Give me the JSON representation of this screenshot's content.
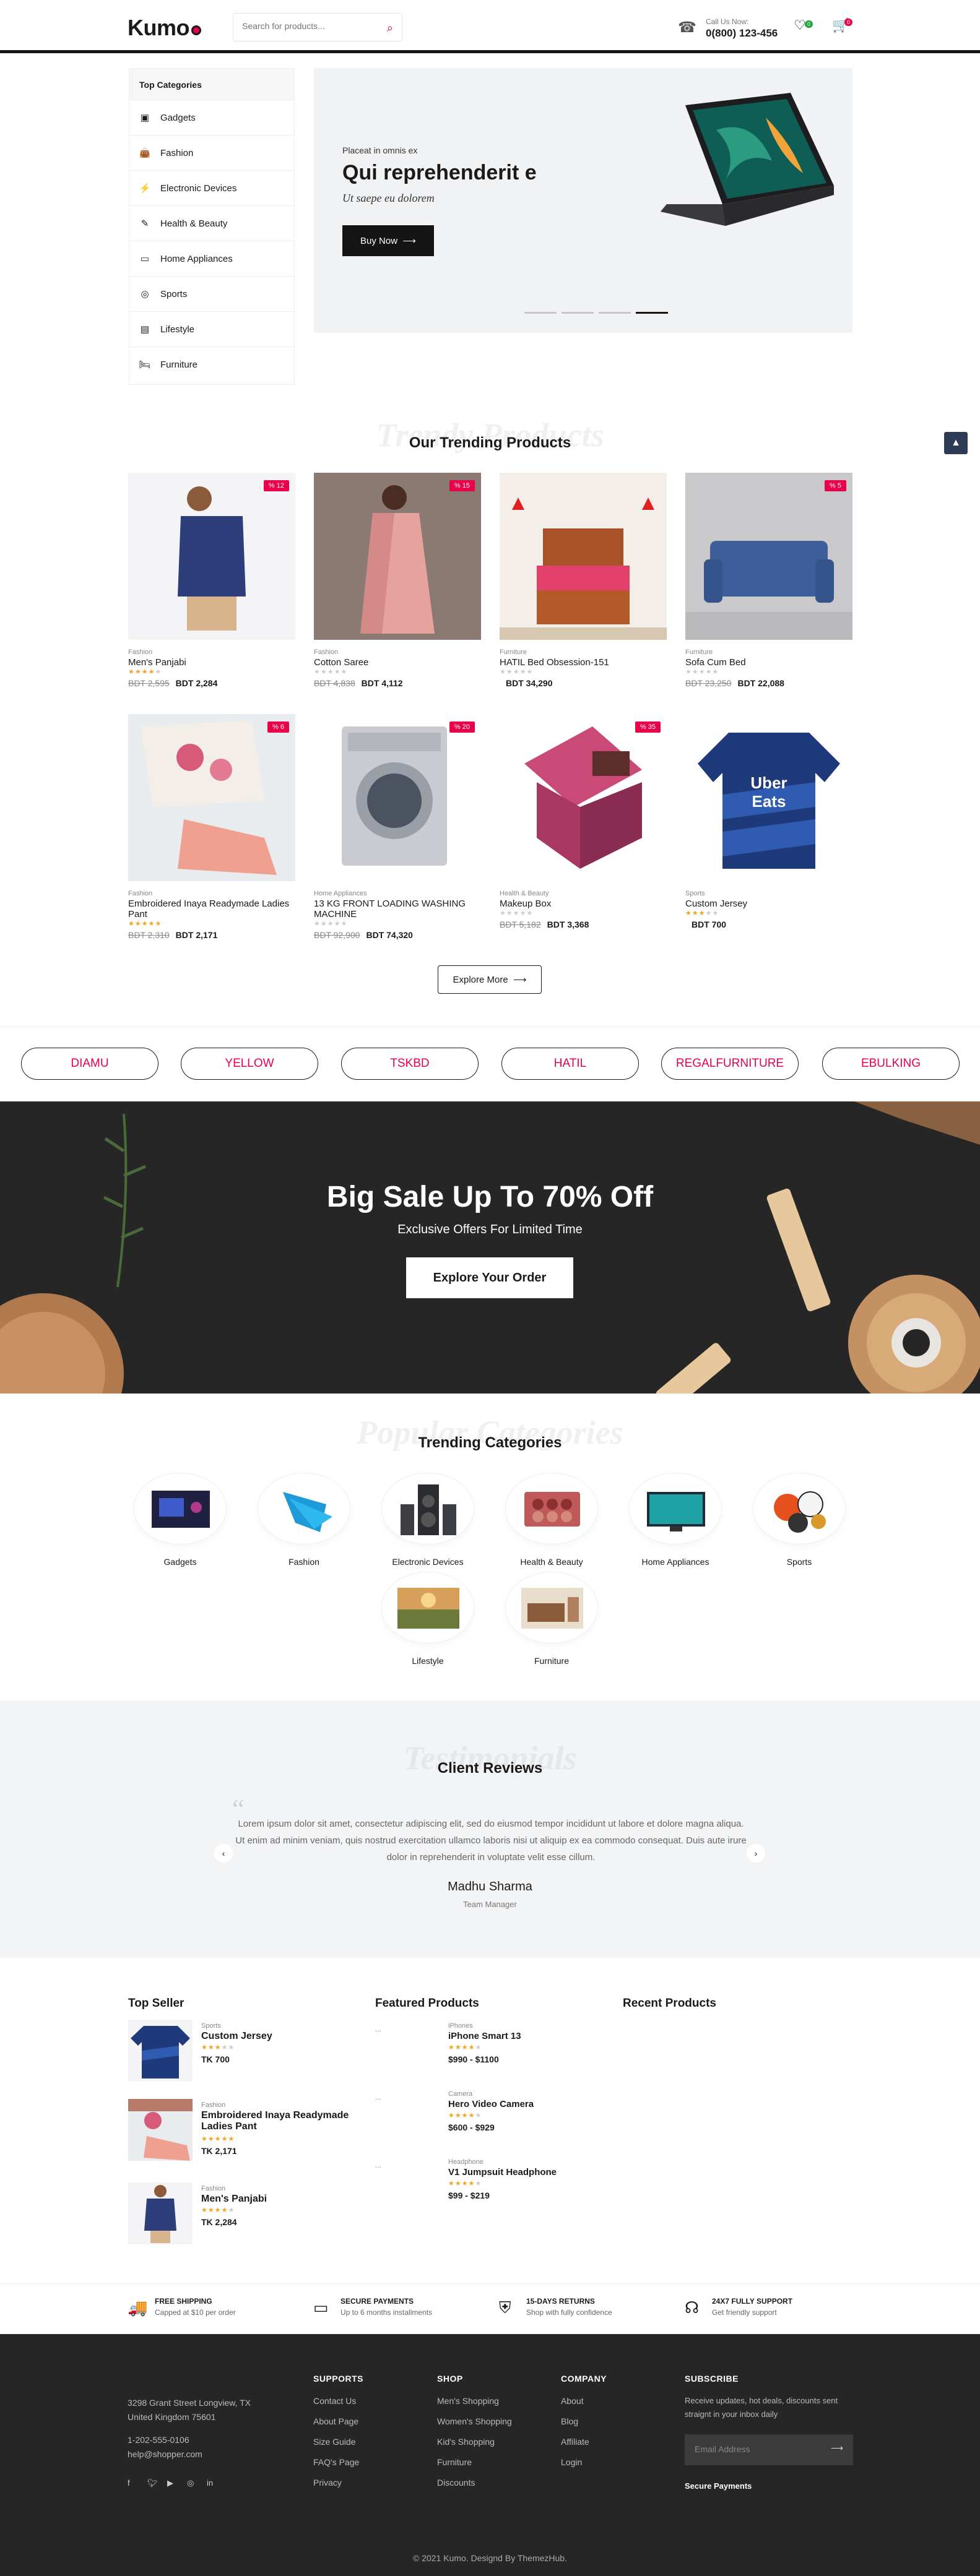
{
  "header": {
    "logo": "Kumo",
    "search_placeholder": "Search for products...",
    "call_label": "Call Us Now:",
    "call_number": "0(800) 123-456",
    "wishlist_count": "0",
    "cart_count": "0"
  },
  "categories": {
    "title": "Top Categories",
    "items": [
      {
        "label": "Gadgets",
        "icon": "gadget-icon"
      },
      {
        "label": "Fashion",
        "icon": "bag-icon"
      },
      {
        "label": "Electronic Devices",
        "icon": "bolt-icon"
      },
      {
        "label": "Health & Beauty",
        "icon": "brush-icon"
      },
      {
        "label": "Home Appliances",
        "icon": "monitor-icon"
      },
      {
        "label": "Sports",
        "icon": "ball-icon"
      },
      {
        "label": "Lifestyle",
        "icon": "book-icon"
      },
      {
        "label": "Furniture",
        "icon": "bed-icon"
      }
    ]
  },
  "hero": {
    "subtitle": "Placeat in omnis ex",
    "title": "Qui reprehenderit e",
    "italic": "Ut saepe eu dolorem",
    "button": "Buy Now"
  },
  "trending": {
    "ghost": "Trendy Products",
    "title": "Our Trending Products",
    "explore": "Explore More",
    "products": [
      {
        "discount": "% 12",
        "cat": "Fashion",
        "name": "Men's Panjabi",
        "stars": 4,
        "old": "BDT 2,595",
        "price": "BDT 2,284"
      },
      {
        "discount": "% 15",
        "cat": "Fashion",
        "name": "Cotton Saree",
        "stars": 0,
        "old": "BDT 4,838",
        "price": "BDT 4,112"
      },
      {
        "discount": "",
        "cat": "Furniture",
        "name": "HATIL Bed Obsession-151",
        "stars": 0,
        "old": "",
        "price": "BDT 34,290"
      },
      {
        "discount": "% 5",
        "cat": "Furniture",
        "name": "Sofa Cum Bed",
        "stars": 0,
        "old": "BDT 23,250",
        "price": "BDT 22,088"
      },
      {
        "discount": "% 6",
        "cat": "Fashion",
        "name": "Embroidered Inaya Readymade Ladies Pant",
        "stars": 5,
        "old": "BDT 2,310",
        "price": "BDT 2,171"
      },
      {
        "discount": "% 20",
        "cat": "Home Appliances",
        "name": "13 KG FRONT LOADING WASHING MACHINE",
        "stars": 0,
        "old": "BDT 92,900",
        "price": "BDT 74,320"
      },
      {
        "discount": "% 35",
        "cat": "Health & Beauty",
        "name": "Makeup Box",
        "stars": 0,
        "old": "BDT 5,182",
        "price": "BDT 3,368"
      },
      {
        "discount": "",
        "cat": "Sports",
        "name": "Custom Jersey",
        "stars": 3,
        "old": "",
        "price": "BDT 700"
      }
    ]
  },
  "brands": [
    "DIAMU",
    "YELLOW",
    "TSKBD",
    "HATIL",
    "REGALFURNITURE",
    "EBULKING"
  ],
  "sale": {
    "title": "Big Sale Up To 70% Off",
    "subtitle": "Exclusive Offers For Limited Time",
    "button": "Explore Your Order"
  },
  "trend_cats": {
    "ghost": "Popular Categories",
    "title": "Trending Categories",
    "items": [
      "Gadgets",
      "Fashion",
      "Electronic Devices",
      "Health & Beauty",
      "Home Appliances",
      "Sports",
      "Lifestyle",
      "Furniture"
    ]
  },
  "reviews": {
    "ghost": "Testimonials",
    "title": "Client Reviews",
    "text": "Lorem ipsum dolor sit amet, consectetur adipiscing elit, sed do eiusmod tempor incididunt ut labore et dolore magna aliqua. Ut enim ad minim veniam, quis nostrud exercitation ullamco laboris nisi ut aliquip ex ea commodo consequat. Duis aute irure dolor in reprehenderit in voluptate velit esse cillum.",
    "name": "Madhu Sharma",
    "role": "Team Manager"
  },
  "top_seller": {
    "title": "Top Seller",
    "items": [
      {
        "cat": "Sports",
        "name": "Custom Jersey",
        "stars": 3,
        "price": "TK 700"
      },
      {
        "cat": "Fashion",
        "name": "Embroidered Inaya Readymade Ladies Pant",
        "stars": 5,
        "price": "TK 2,171"
      },
      {
        "cat": "Fashion",
        "name": "Men's Panjabi",
        "stars": 4,
        "price": "TK 2,284"
      }
    ]
  },
  "featured": {
    "title": "Featured Products",
    "items": [
      {
        "cat": "iPhones",
        "name": "iPhone Smart 13",
        "stars": 4,
        "price": "$990 - $1100"
      },
      {
        "cat": "Camera",
        "name": "Hero Video Camera",
        "stars": 4,
        "price": "$600 - $929"
      },
      {
        "cat": "Headphone",
        "name": "V1 Jumpsuit Headphone",
        "stars": 4,
        "price": "$99 - $219"
      }
    ]
  },
  "recent": {
    "title": "Recent Products"
  },
  "services": [
    {
      "icon": "truck-icon",
      "title": "FREE SHIPPING",
      "desc": "Capped at $10 per order"
    },
    {
      "icon": "card-icon",
      "title": "SECURE PAYMENTS",
      "desc": "Up to 6 months installments"
    },
    {
      "icon": "shield-icon",
      "title": "15-DAYS RETURNS",
      "desc": "Shop with fully confidence"
    },
    {
      "icon": "headset-icon",
      "title": "24X7 FULLY SUPPORT",
      "desc": "Get friendly support"
    }
  ],
  "footer": {
    "address1": "3298 Grant Street Longview, TX",
    "address2": "United Kingdom 75601",
    "phone": "1-202-555-0106",
    "email": "help@shopper.com",
    "supports": {
      "title": "SUPPORTS",
      "links": [
        "Contact Us",
        "About Page",
        "Size Guide",
        "FAQ's Page",
        "Privacy"
      ]
    },
    "shop": {
      "title": "SHOP",
      "links": [
        "Men's Shopping",
        "Women's Shopping",
        "Kid's Shopping",
        "Furniture",
        "Discounts"
      ]
    },
    "company": {
      "title": "COMPANY",
      "links": [
        "About",
        "Blog",
        "Affiliate",
        "Login"
      ]
    },
    "subscribe": {
      "title": "SUBSCRIBE",
      "text1": "Receive updates, hot deals, discounts sent",
      "text2": "straignt in your inbox daily",
      "placeholder": "Email Address",
      "secure": "Secure Payments"
    },
    "copyright": "© 2021 Kumo. Designd By ThemezHub."
  },
  "colors": {
    "accent": "#e8004a",
    "dark": "#141414",
    "footer": "#262626"
  }
}
